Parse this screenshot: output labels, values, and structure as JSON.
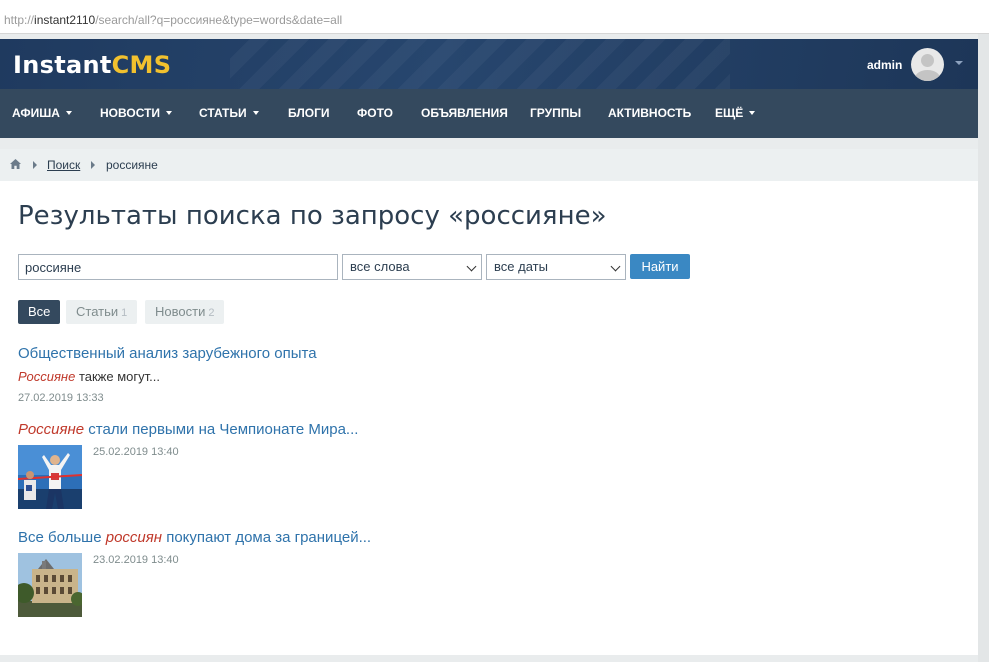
{
  "browser": {
    "url_prefix": "http://",
    "url_host": "instant2110",
    "url_path": "/search/all?q=россияне&type=words&date=all"
  },
  "header": {
    "logo_part1": "Instant",
    "logo_part2": "CMS",
    "user_name": "admin"
  },
  "nav": {
    "items": [
      {
        "label": "АФИША",
        "dropdown": true
      },
      {
        "label": "НОВОСТИ",
        "dropdown": true
      },
      {
        "label": "СТАТЬИ",
        "dropdown": true
      },
      {
        "label": "БЛОГИ",
        "dropdown": false
      },
      {
        "label": "ФОТО",
        "dropdown": false
      },
      {
        "label": "ОБЪЯВЛЕНИЯ",
        "dropdown": false
      },
      {
        "label": "ГРУППЫ",
        "dropdown": false
      },
      {
        "label": "АКТИВНОСТЬ",
        "dropdown": false
      },
      {
        "label": "ЕЩЁ",
        "dropdown": true
      }
    ]
  },
  "breadcrumb": {
    "link": "Поиск",
    "current": "россияне"
  },
  "page": {
    "title": "Результаты поиска по запросу «россияне»"
  },
  "search": {
    "query": "россияне",
    "type_selected": "все слова",
    "date_selected": "все даты",
    "submit_label": "Найти"
  },
  "tabs": [
    {
      "label": "Все",
      "count": ""
    },
    {
      "label": "Статьи",
      "count": "1"
    },
    {
      "label": "Новости",
      "count": "2"
    }
  ],
  "results": [
    {
      "title_pre": "Общественный анализ зарубежного опыта",
      "title_hl": "",
      "title_post": "",
      "snippet_hl": "Россияне",
      "snippet_rest": " также могут...",
      "date": "27.02.2019 13:33"
    },
    {
      "title_pre": "",
      "title_hl": "Россияне",
      "title_post": " стали первыми на Чемпионате Мира...",
      "date": "25.02.2019 13:40",
      "thumb_icon": "runners-photo"
    },
    {
      "title_pre": "Все больше ",
      "title_hl": "россиян",
      "title_post": " покупают дома за границей...",
      "date": "23.02.2019 13:40",
      "thumb_icon": "building-photo"
    }
  ],
  "colors": {
    "header_bg": "#1f3a5f",
    "nav_bg": "#34495e",
    "link": "#2f73ab",
    "highlight": "#c0392b",
    "button": "#3a88c3",
    "logo_accent": "#f2c12e"
  }
}
